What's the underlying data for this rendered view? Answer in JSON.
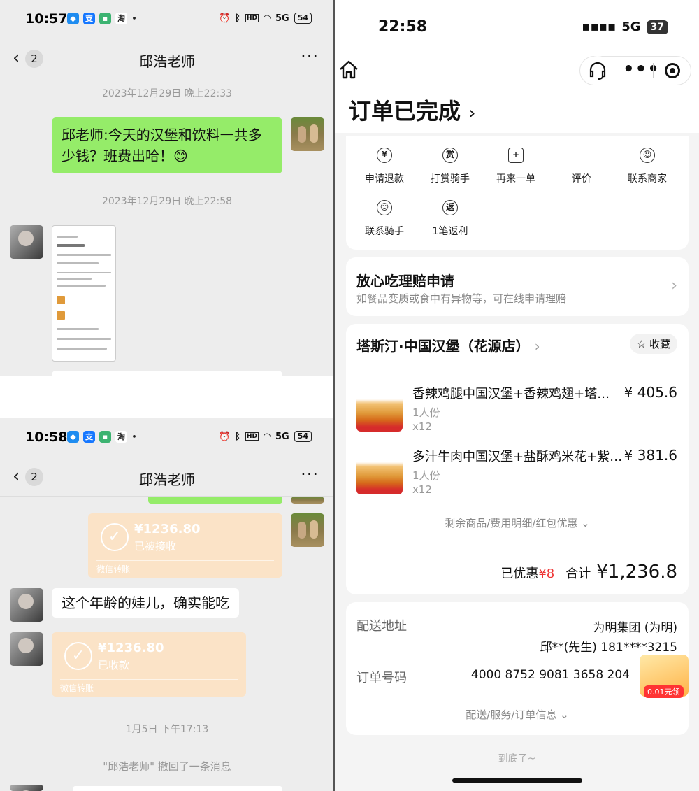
{
  "top_left": {
    "status": {
      "time": "10:57",
      "battery": "54",
      "network": "5G"
    },
    "nav": {
      "back_badge": "2",
      "title": "邱浩老师",
      "more": "···"
    },
    "timestamp1": "2023年12月29日 晚上22:33",
    "msg1": "邱老师:今天的汉堡和饮料一共多少钱？班费出哈！😊",
    "timestamp2": "2023年12月29日 晚上22:58"
  },
  "bottom_left": {
    "status": {
      "time": "10:58",
      "battery": "54",
      "network": "5G"
    },
    "nav": {
      "back_badge": "2",
      "title": "邱浩老师",
      "more": "···"
    },
    "transfer1": {
      "amount": "¥1236.80",
      "status": "已被接收",
      "footer": "微信转账"
    },
    "msg2": "这个年龄的娃儿，确实能吃",
    "transfer2": {
      "amount": "¥1236.80",
      "status": "已收款",
      "footer": "微信转账"
    },
    "timestamp3": "1月5日 下午17:13",
    "recall": "\"邱浩老师\" 撤回了一条消息"
  },
  "order": {
    "status": {
      "time": "22:58",
      "network": "5G",
      "battery": "37"
    },
    "title": "订单已完成",
    "actions": [
      {
        "label": "申请退款",
        "icon": "¥"
      },
      {
        "label": "打赏骑手",
        "icon": "赏"
      },
      {
        "label": "再来一单",
        "icon": "+"
      },
      {
        "label": "评价",
        "icon": ""
      },
      {
        "label": "联系商家",
        "icon": "☺"
      },
      {
        "label": "联系骑手",
        "icon": "☺"
      },
      {
        "label": "1笔返利",
        "icon": "返"
      }
    ],
    "claim": {
      "title": "放心吃理赔申请",
      "subtitle": "如餐品变质或食中有异物等，可在线申请理赔"
    },
    "store": {
      "name": "塔斯汀·中国汉堡（花源店）",
      "fav": "收藏"
    },
    "items": [
      {
        "name": "香辣鸡腿中国汉堡+香辣鸡翅+塔…",
        "price": "¥ 405.6",
        "serving": "1人份",
        "qty": "x12"
      },
      {
        "name": "多汁牛肉中国汉堡+盐酥鸡米花+紫…",
        "price": "¥ 381.6",
        "serving": "1人份",
        "qty": "x12"
      }
    ],
    "more": "剩余商品/费用明细/红包优惠",
    "discount_label": "已优惠",
    "discount": "¥8",
    "total_label": "合计",
    "total": "¥1,236.8",
    "delivery": {
      "addr_label": "配送地址",
      "addr1": "为明集团 (为明)",
      "addr2": "邱**(先生) 181****3215",
      "order_label": "订单号码",
      "order_no": "4000 8752 9081 3658 204",
      "more": "配送/服务/订单信息",
      "promo": "0.01元领"
    },
    "end": "到底了~"
  }
}
